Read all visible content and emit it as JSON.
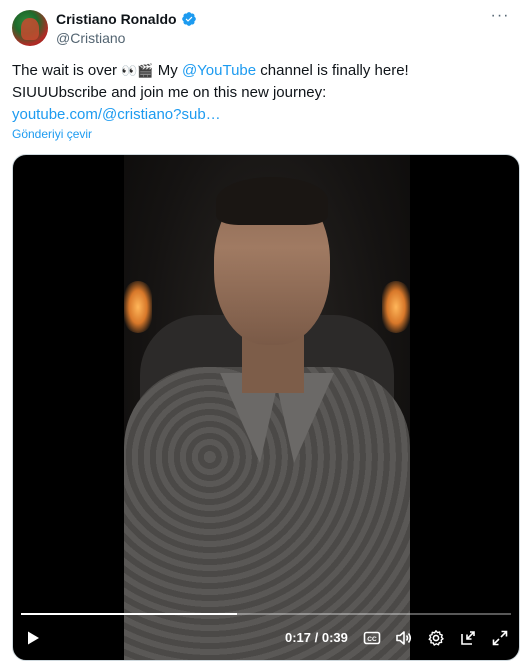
{
  "author": {
    "name": "Cristiano Ronaldo",
    "handle": "@Cristiano",
    "verified": true
  },
  "tweet": {
    "line1_prefix": "The wait is over",
    "line1_mid": " My ",
    "mention": "@YouTube",
    "line1_suffix": " channel is finally here!",
    "line2": "SIUUUbscribe and join me on this new journey:",
    "link": "youtube.com/@cristiano?sub…",
    "translate": "Gönderiyi çevir"
  },
  "video": {
    "current_time": "0:17",
    "separator": " / ",
    "duration": "0:39",
    "progress": 0.44
  },
  "icons": {
    "more": "more-icon",
    "play": "play-icon",
    "captions": "captions-icon",
    "volume": "volume-icon",
    "settings": "settings-icon",
    "pip": "pip-icon",
    "fullscreen": "fullscreen-icon"
  },
  "colors": {
    "accent": "#1d9bf0",
    "text": "#0f1419",
    "secondary": "#536471"
  }
}
